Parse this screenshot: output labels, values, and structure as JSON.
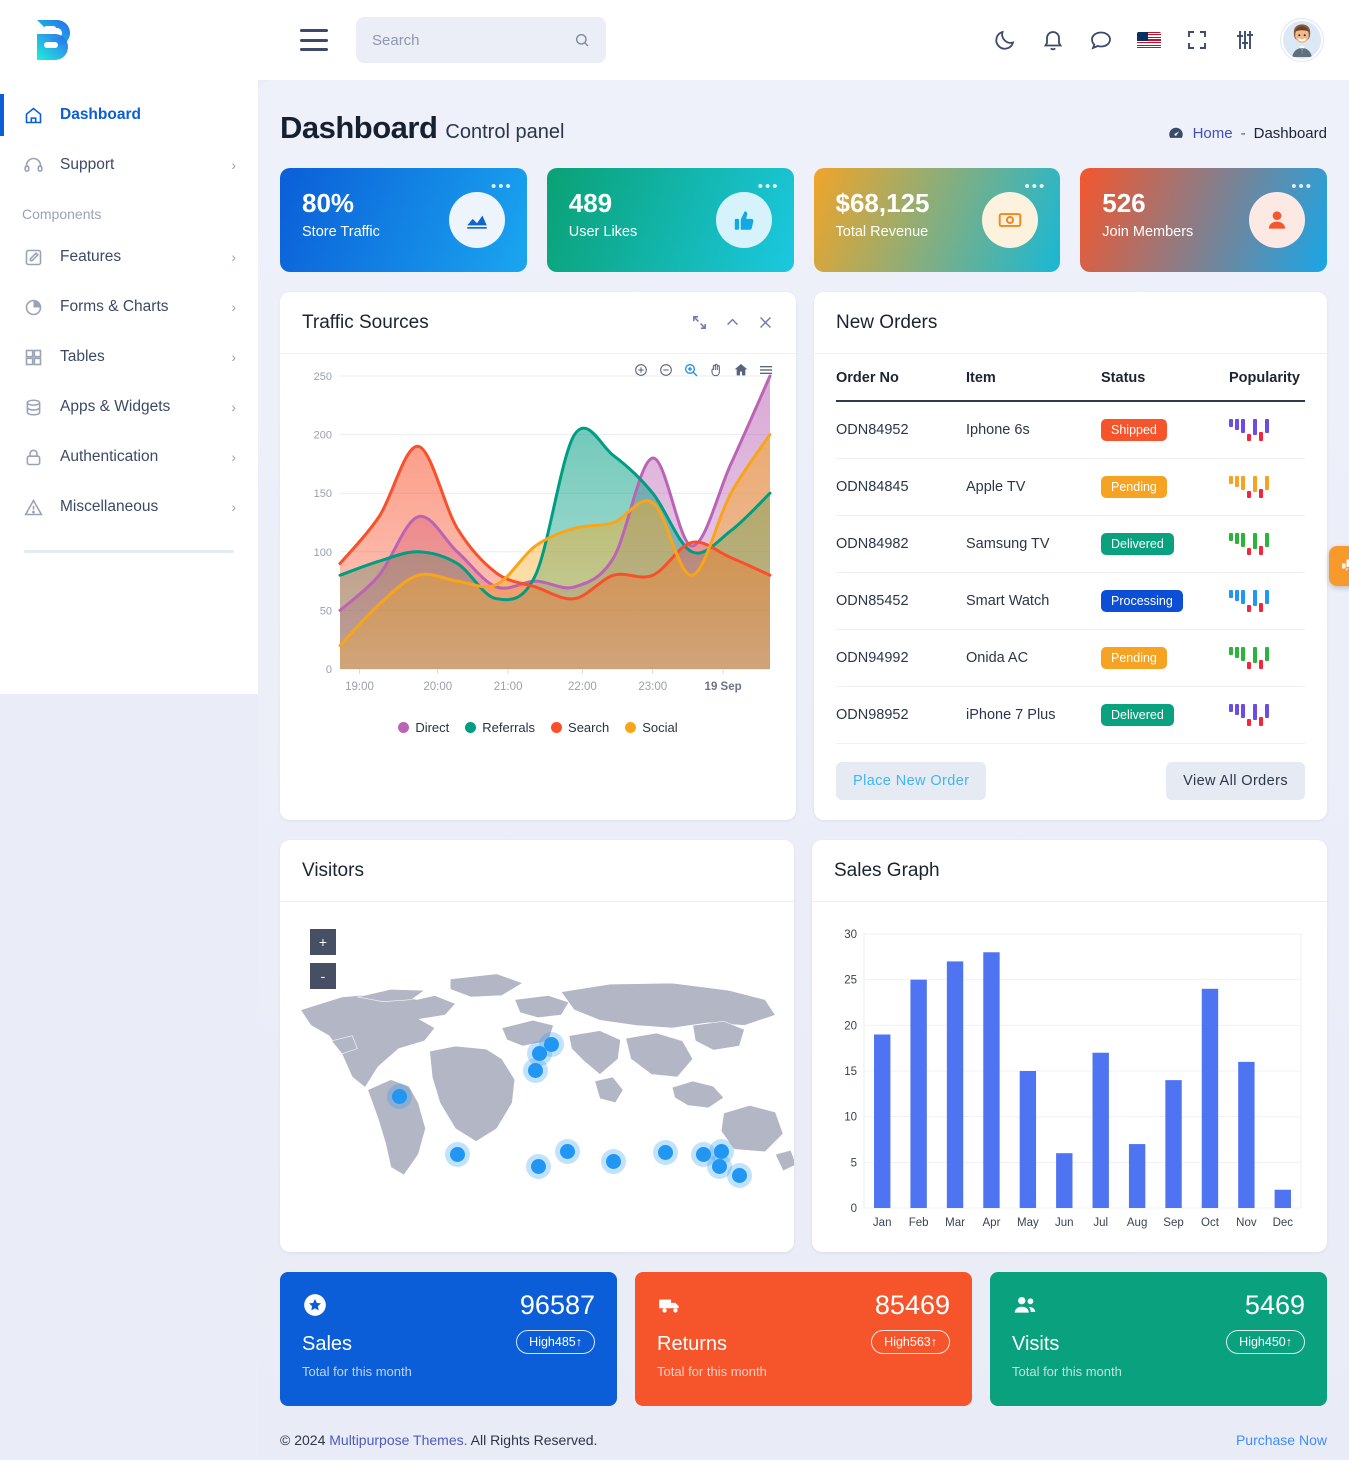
{
  "header": {
    "logo_icon": "brand-b-logo",
    "menu_icon": "hamburger-icon",
    "search": {
      "value": "",
      "placeholder": "Search",
      "icon": "search-icon"
    },
    "actions": [
      {
        "name": "dark-mode-icon",
        "label": "Dark mode"
      },
      {
        "name": "notifications-icon",
        "label": "Notifications"
      },
      {
        "name": "messages-icon",
        "label": "Messages"
      },
      {
        "name": "language-flag-icon",
        "label": "English (US)"
      },
      {
        "name": "fullscreen-icon",
        "label": "Fullscreen"
      },
      {
        "name": "settings-sliders-icon",
        "label": "Settings"
      }
    ],
    "avatar_label": "User profile"
  },
  "sidebar": {
    "section_label": "Components",
    "items": [
      {
        "label": "Dashboard",
        "icon": "home-icon",
        "active": true,
        "has_chevron": false
      },
      {
        "label": "Support",
        "icon": "headset-icon",
        "active": false,
        "has_chevron": true
      },
      {
        "label": "Features",
        "icon": "edit-square-icon",
        "active": false,
        "has_chevron": true
      },
      {
        "label": "Forms & Charts",
        "icon": "pie-chart-icon",
        "active": false,
        "has_chevron": true
      },
      {
        "label": "Tables",
        "icon": "grid-icon",
        "active": false,
        "has_chevron": true
      },
      {
        "label": "Apps & Widgets",
        "icon": "database-icon",
        "active": false,
        "has_chevron": true
      },
      {
        "label": "Authentication",
        "icon": "lock-icon",
        "active": false,
        "has_chevron": true
      },
      {
        "label": "Miscellaneous",
        "icon": "warning-triangle-icon",
        "active": false,
        "has_chevron": true
      }
    ]
  },
  "page": {
    "title": "Dashboard",
    "subtitle": "Control panel",
    "breadcrumb": {
      "icon": "speedometer-icon",
      "home": "Home",
      "separator": "-",
      "current": "Dashboard"
    }
  },
  "stat_cards": [
    {
      "value": "80%",
      "label": "Store Traffic",
      "icon": "area-chart-icon",
      "menu": "•••"
    },
    {
      "value": "489",
      "label": "User Likes",
      "icon": "thumbs-up-icon",
      "menu": "•••"
    },
    {
      "value": "$68,125",
      "label": "Total Revenue",
      "icon": "money-bill-icon",
      "menu": "•••"
    },
    {
      "value": "526",
      "label": "Join Members",
      "icon": "user-icon",
      "menu": "•••"
    }
  ],
  "traffic_card": {
    "title": "Traffic Sources",
    "tools": [
      "expand-icon",
      "collapse-icon",
      "close-icon"
    ],
    "chart_toolbar": [
      "zoom-in-icon",
      "zoom-out-icon",
      "selection-zoom-icon",
      "pan-icon",
      "reset-home-icon",
      "menu-icon"
    ]
  },
  "orders_card": {
    "title": "New Orders",
    "columns": [
      "Order No",
      "Item",
      "Status",
      "Popularity"
    ],
    "rows": [
      {
        "order_no": "ODN84952",
        "item": "Iphone 6s",
        "status": "Shipped",
        "status_color": "#f6542b",
        "spark_color": "#6b4ce6"
      },
      {
        "order_no": "ODN84845",
        "item": "Apple TV",
        "status": "Pending",
        "status_color": "#f6a323",
        "spark_color": "#f6a323"
      },
      {
        "order_no": "ODN84982",
        "item": "Samsung TV",
        "status": "Delivered",
        "status_color": "#0aa17f",
        "spark_color": "#2bb33a"
      },
      {
        "order_no": "ODN85452",
        "item": "Smart Watch",
        "status": "Processing",
        "status_color": "#0b4fd7",
        "spark_color": "#2196f3"
      },
      {
        "order_no": "ODN94992",
        "item": "Onida AC",
        "status": "Pending",
        "status_color": "#f6a323",
        "spark_color": "#2bb33a"
      },
      {
        "order_no": "ODN98952",
        "item": "iPhone 7 Plus",
        "status": "Delivered",
        "status_color": "#0aa17f",
        "spark_color": "#6b4ce6"
      }
    ],
    "place_order_label": "Place New Order",
    "view_all_label": "View All Orders"
  },
  "visitors_card": {
    "title": "Visitors",
    "zoom_in": "+",
    "zoom_out": "-"
  },
  "sales_card": {
    "title": "Sales Graph"
  },
  "bottom_stats": [
    {
      "value": "96587",
      "name": "Sales",
      "sub": "Total for this month",
      "pill": "High485↑",
      "icon": "star-badge-icon",
      "color": "#0b5ed7"
    },
    {
      "value": "85469",
      "name": "Returns",
      "sub": "Total for this month",
      "pill": "High563↑",
      "icon": "truck-icon",
      "color": "#f6542b"
    },
    {
      "value": "5469",
      "name": "Visits",
      "sub": "Total for this month",
      "pill": "High450↑",
      "icon": "people-icon",
      "color": "#0aa17f"
    }
  ],
  "footer": {
    "copyright_pre": "© 2024 ",
    "brand": "Multipurpose Themes.",
    "copyright_post": " All Rights Reserved.",
    "purchase": "Purchase Now"
  },
  "fab": {
    "icon": "chat-bubbles-icon"
  },
  "chart_data": [
    {
      "type": "area",
      "title": "Traffic Sources",
      "xlabel": "",
      "ylabel": "",
      "ylim": [
        0,
        250
      ],
      "yticks": [
        0,
        50,
        100,
        150,
        200,
        250
      ],
      "xticks": [
        "19:00",
        "20:00",
        "21:00",
        "22:00",
        "23:00",
        "19 Sep"
      ],
      "grid": true,
      "legend_position": "bottom",
      "x": [
        0,
        1,
        2,
        3,
        4,
        5,
        6,
        7,
        8,
        9,
        10,
        11
      ],
      "series": [
        {
          "name": "Direct",
          "color": "#bb64b5",
          "values": [
            50,
            80,
            130,
            100,
            70,
            75,
            70,
            95,
            180,
            105,
            175,
            250
          ]
        },
        {
          "name": "Referrals",
          "color": "#009d82",
          "values": [
            80,
            92,
            100,
            90,
            60,
            80,
            200,
            182,
            150,
            100,
            118,
            150
          ]
        },
        {
          "name": "Search",
          "color": "#f9502b",
          "values": [
            90,
            130,
            190,
            120,
            82,
            70,
            60,
            80,
            80,
            108,
            95,
            80
          ]
        },
        {
          "name": "Social",
          "color": "#f9a51a",
          "values": [
            20,
            55,
            80,
            75,
            72,
            105,
            120,
            125,
            142,
            80,
            150,
            200
          ]
        }
      ]
    },
    {
      "type": "bar",
      "title": "Sales Graph",
      "xlabel": "",
      "ylabel": "",
      "ylim": [
        0,
        30
      ],
      "yticks": [
        0,
        5,
        10,
        15,
        20,
        25,
        30
      ],
      "grid": true,
      "bar_color": "#4f74f2",
      "categories": [
        "Jan",
        "Feb",
        "Mar",
        "Apr",
        "May",
        "Jun",
        "Jul",
        "Aug",
        "Sep",
        "Oct",
        "Nov",
        "Dec"
      ],
      "values": [
        19,
        25,
        27,
        28,
        15,
        6,
        17,
        7,
        14,
        24,
        16,
        2
      ]
    }
  ],
  "map_markers": [
    {
      "x": 21.8,
      "y": 53.5
    },
    {
      "x": 49.0,
      "y": 41.0
    },
    {
      "x": 51.4,
      "y": 38.5
    },
    {
      "x": 48.2,
      "y": 46.0
    },
    {
      "x": 33.0,
      "y": 70.0
    },
    {
      "x": 48.8,
      "y": 73.5
    },
    {
      "x": 54.5,
      "y": 69.0
    },
    {
      "x": 63.5,
      "y": 72.0
    },
    {
      "x": 73.5,
      "y": 69.5
    },
    {
      "x": 81.0,
      "y": 70.0
    },
    {
      "x": 84.5,
      "y": 69.0
    },
    {
      "x": 84.0,
      "y": 73.5
    },
    {
      "x": 88.0,
      "y": 76.0
    }
  ]
}
